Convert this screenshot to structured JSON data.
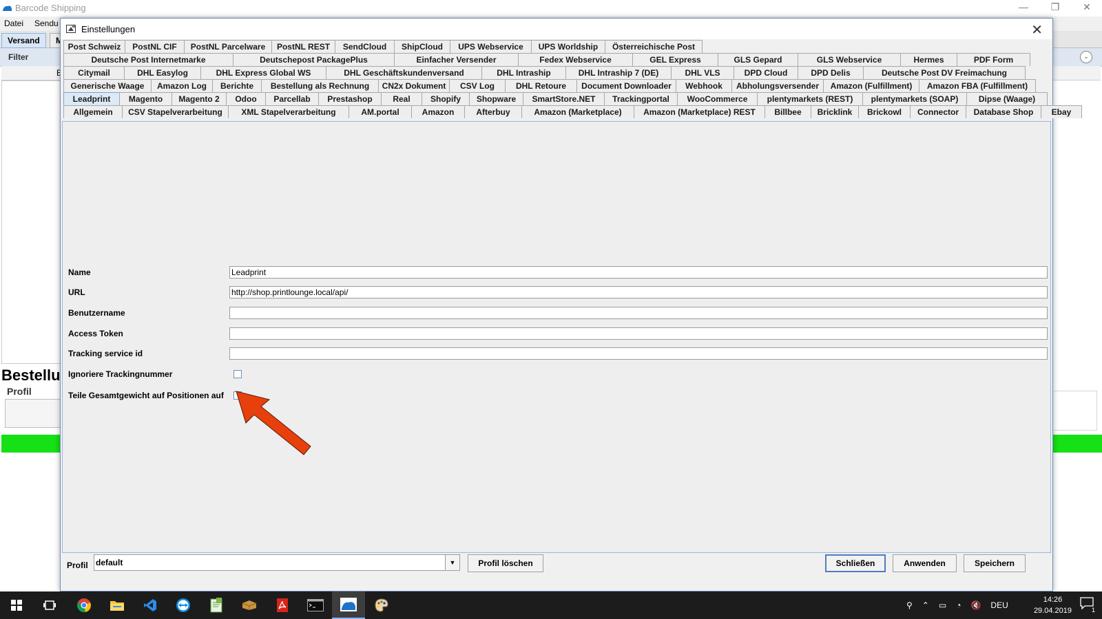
{
  "main_window": {
    "title": "Barcode Shipping",
    "menu": [
      "Datei",
      "Sendu"
    ],
    "tabs": [
      "Versand",
      "M"
    ],
    "filter_label": "Filter",
    "column_fragment": "E",
    "heading": "Bestellu",
    "profil_label": "Profil",
    "status_color": "#16e016"
  },
  "dialog": {
    "title": "Einstellungen",
    "close_glyph": "✕",
    "tab_rows": [
      [
        "Post Schweiz",
        "PostNL CIF",
        "PostNL Parcelware",
        "PostNL REST",
        "SendCloud",
        "ShipCloud",
        "UPS Webservice",
        "UPS Worldship",
        "Österreichische Post"
      ],
      [
        "Deutsche Post Internetmarke",
        "Deutschepost PackagePlus",
        "Einfacher Versender",
        "Fedex Webservice",
        "GEL Express",
        "GLS Gepard",
        "GLS Webservice",
        "Hermes",
        "PDF Form"
      ],
      [
        "Citymail",
        "DHL Easylog",
        "DHL Express Global WS",
        "DHL Geschäftskundenversand",
        "DHL Intraship",
        "DHL Intraship 7 (DE)",
        "DHL VLS",
        "DPD Cloud",
        "DPD Delis",
        "Deutsche Post DV Freimachung"
      ],
      [
        "Generische Waage",
        "Amazon Log",
        "Berichte",
        "Bestellung als Rechnung",
        "CN2x Dokument",
        "CSV Log",
        "DHL Retoure",
        "Document Downloader",
        "Webhook",
        "Abholungsversender",
        "Amazon (Fulfillment)",
        "Amazon FBA (Fulfillment)"
      ],
      [
        "Leadprint",
        "Magento",
        "Magento 2",
        "Odoo",
        "Parcellab",
        "Prestashop",
        "Real",
        "Shopify",
        "Shopware",
        "SmartStore.NET",
        "Trackingportal",
        "WooCommerce",
        "plentymarkets (REST)",
        "plentymarkets (SOAP)",
        "Dipse (Waage)"
      ],
      [
        "Allgemein",
        "CSV Stapelverarbeitung",
        "XML Stapelverarbeitung",
        "AM.portal",
        "Amazon",
        "Afterbuy",
        "Amazon (Marketplace)",
        "Amazon (Marketplace) REST",
        "Billbee",
        "Bricklink",
        "Brickowl",
        "Connector",
        "Database Shop",
        "Ebay"
      ]
    ],
    "active_tab": "Leadprint",
    "fields": {
      "name_label": "Name",
      "name_value": "Leadprint",
      "url_label": "URL",
      "url_value": "http://shop.printlounge.local/api/",
      "user_label": "Benutzername",
      "user_value": "",
      "token_label": "Access Token",
      "token_value": "",
      "tracking_label": "Tracking service id",
      "tracking_value": "",
      "ignore_label": "Ignoriere Trackingnummer",
      "ignore_checked": false,
      "split_label": "Teile Gesamtgewicht auf Positionen auf",
      "split_checked": false
    },
    "arrow_color": "#e8400c",
    "profil_label": "Profil",
    "profil_value": "default",
    "buttons": {
      "delete": "Profil löschen",
      "close": "Schließen",
      "apply": "Anwenden",
      "save": "Speichern"
    }
  },
  "taskbar": {
    "icons": [
      "windows-start-icon",
      "task-view-icon",
      "chrome-icon",
      "file-explorer-icon",
      "vscode-icon",
      "teamviewer-icon",
      "notepad-icon",
      "package-icon",
      "acrobat-icon",
      "terminal-icon",
      "barcode-shipping-icon",
      "paint-icon"
    ],
    "language": "DEU",
    "time": "14:26",
    "date": "29.04.2019",
    "notification_count": "1"
  }
}
